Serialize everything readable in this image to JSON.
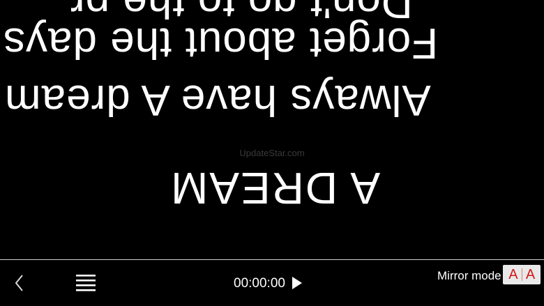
{
  "prompter": {
    "line_top": "Don't go to the pr",
    "line_1": "Forget about the days",
    "line_2": "Always have A dream",
    "line_3": "A DREAM"
  },
  "watermark": "UpdateStar.com",
  "toolbar": {
    "back_icon": "chevron-left-icon",
    "menu_icon": "hamburger-menu-icon",
    "timer": "00:00:00",
    "play_icon": "play-icon",
    "mirror_label": "Mirror mode",
    "mirror_glyph_left": "A",
    "mirror_glyph_right": "A"
  },
  "colors": {
    "background": "#000000",
    "text": "#ffffff",
    "mirror_accent": "#d11a1a",
    "toggle_bg": "#e9e9e9"
  }
}
